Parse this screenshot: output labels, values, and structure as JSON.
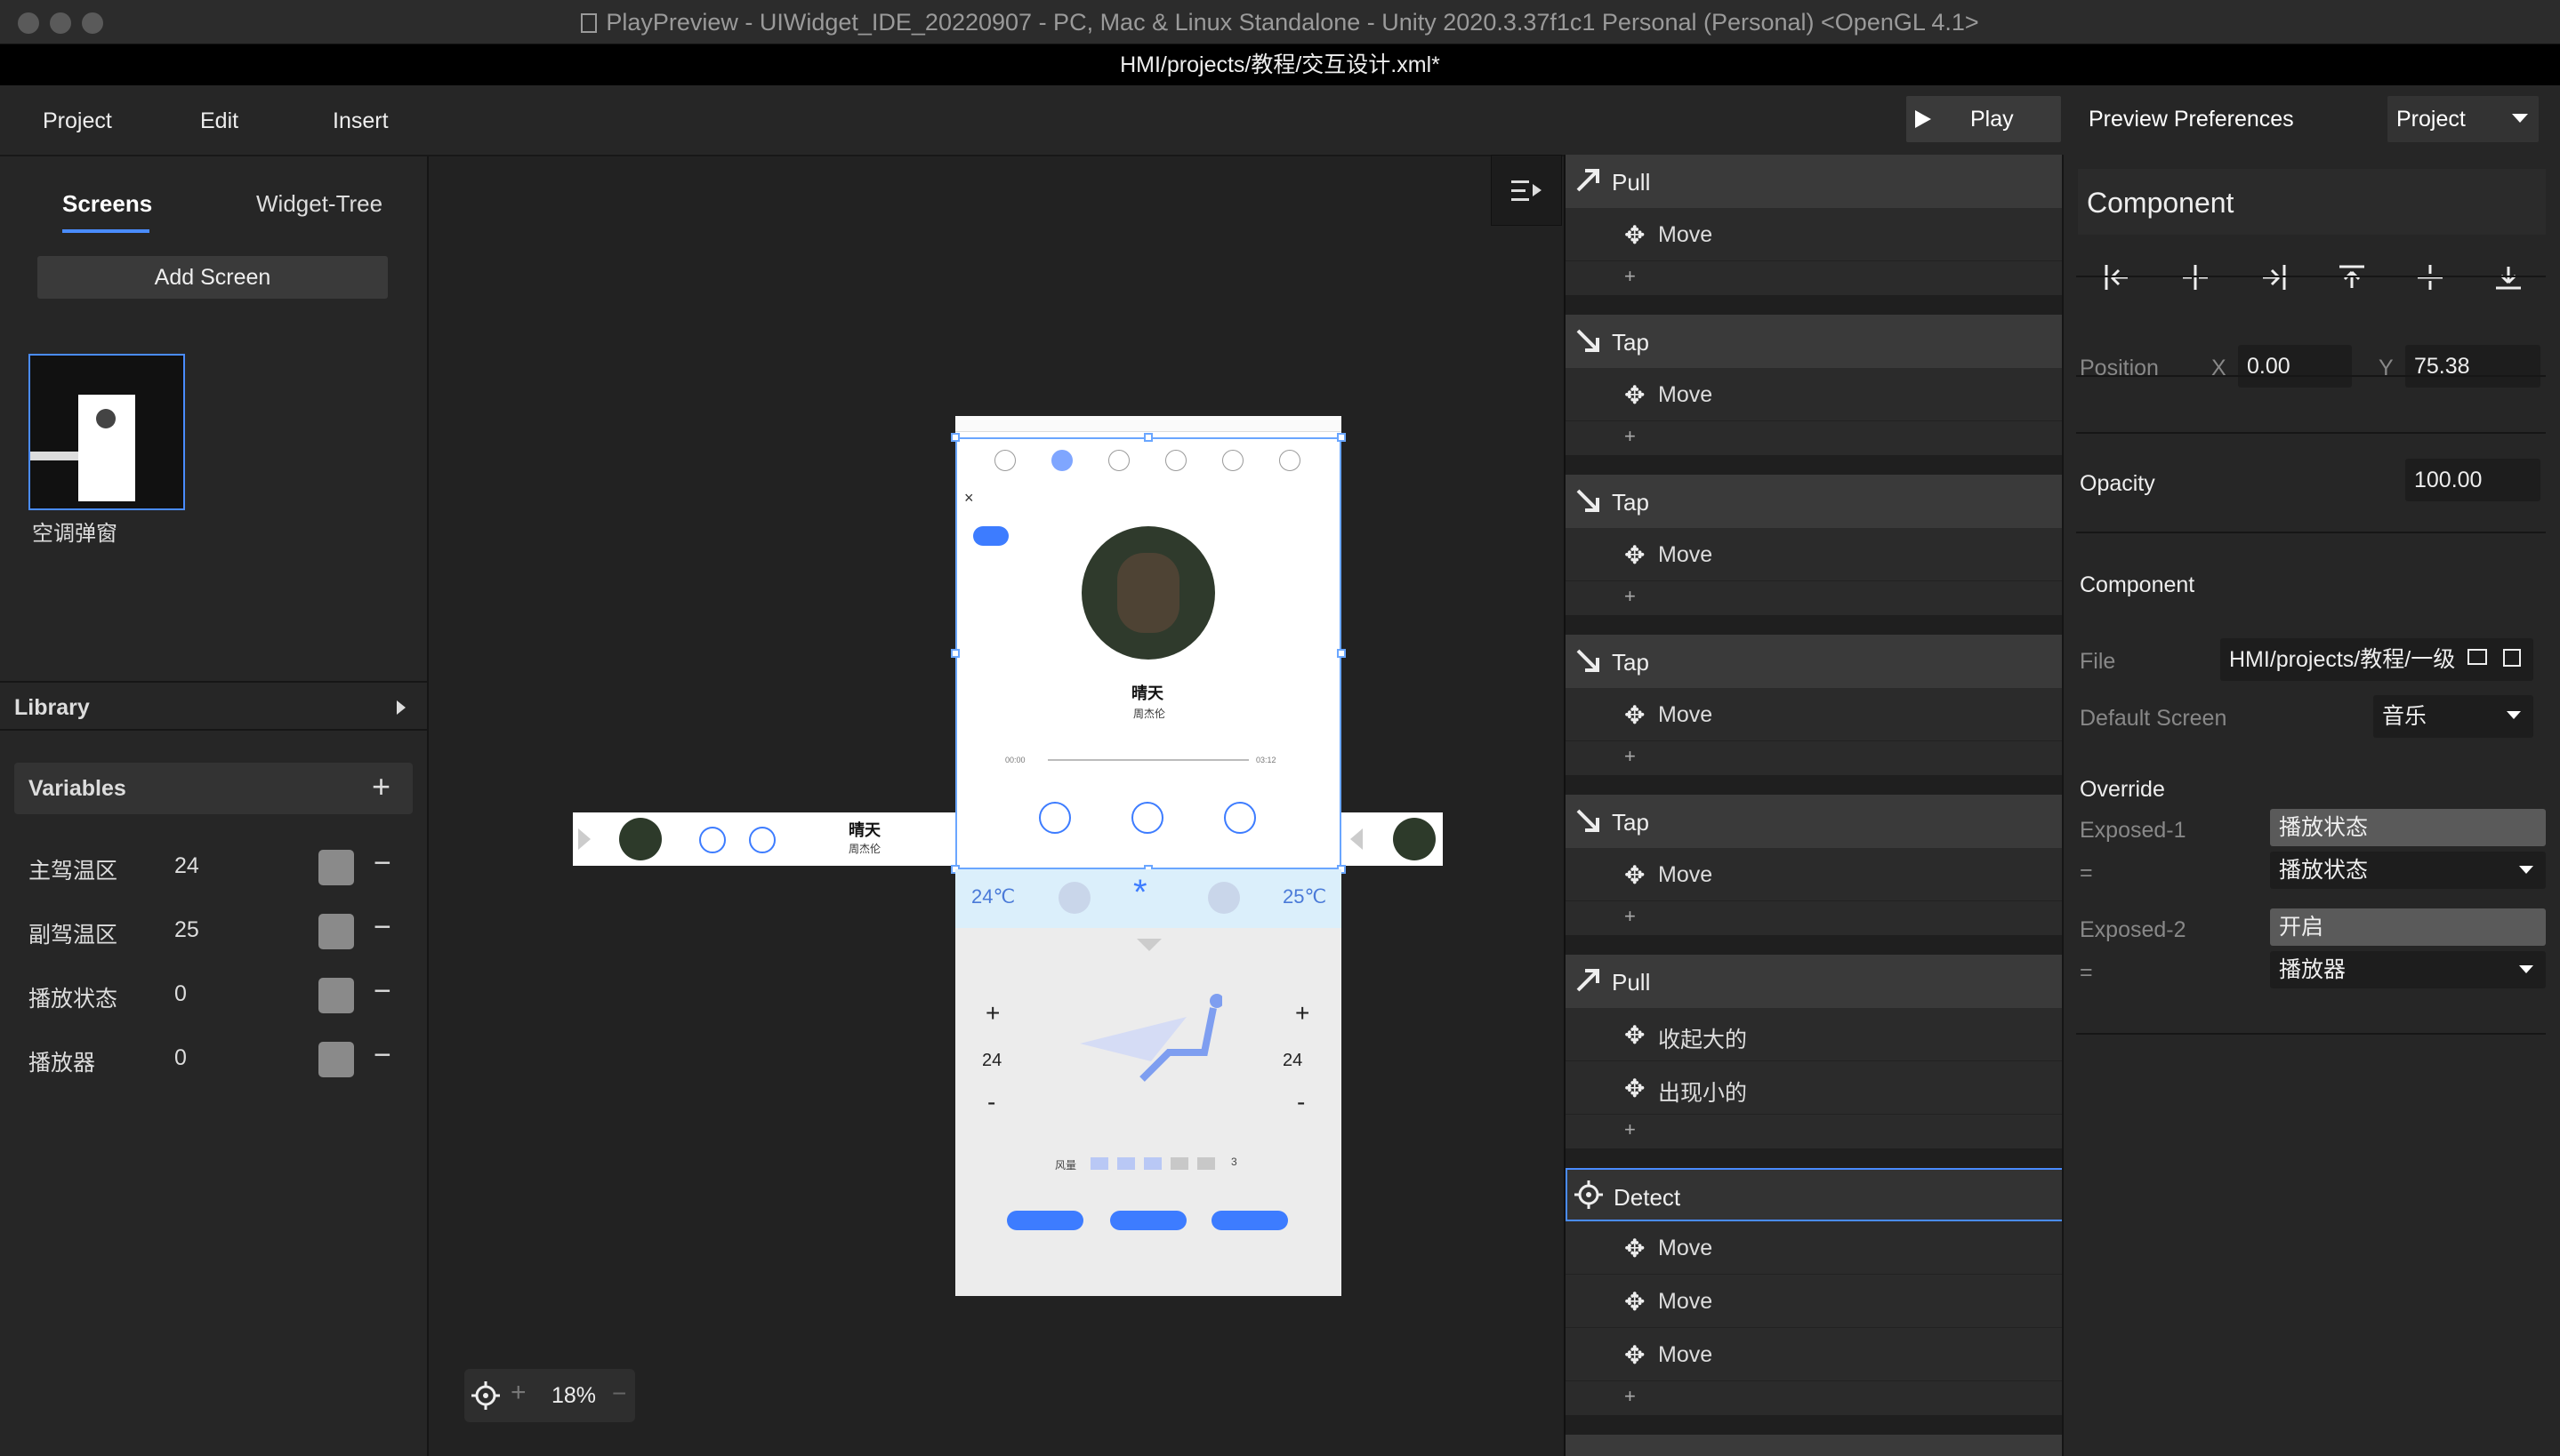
{
  "window": {
    "title": "PlayPreview - UIWidget_IDE_20220907 - PC, Mac & Linux Standalone - Unity 2020.3.37f1c1 Personal (Personal) <OpenGL 4.1>",
    "subtitle": "HMI/projects/教程/交互设计.xml*"
  },
  "menu": {
    "project": "Project",
    "edit": "Edit",
    "insert": "Insert",
    "play": "Play",
    "preferences": "Preview Preferences",
    "project_select": "Project"
  },
  "left": {
    "tab_screens": "Screens",
    "tab_widget_tree": "Widget-Tree",
    "add_screen": "Add Screen",
    "screen_name": "空调弹窗",
    "library": "Library",
    "variables": "Variables",
    "vars": [
      {
        "name": "主驾温区",
        "value": "24"
      },
      {
        "name": "副驾温区",
        "value": "25"
      },
      {
        "name": "播放状态",
        "value": "0"
      },
      {
        "name": "播放器",
        "value": "0"
      }
    ]
  },
  "canvas": {
    "zoom": "18%"
  },
  "phone": {
    "song": "晴天",
    "artist": "周杰伦",
    "time_start": "00:00",
    "time_end": "03:12",
    "temp_left": "24℃",
    "temp_right": "25℃",
    "ac_temp_left": "24",
    "ac_temp_right": "24",
    "wind_label": "风量",
    "wind_value": "3",
    "wind_level": 0.6
  },
  "interactions": [
    {
      "type": "Pull",
      "icon": "pull-icon",
      "actions": [
        "Move"
      ]
    },
    {
      "type": "Tap",
      "icon": "tap-icon",
      "actions": [
        "Move"
      ]
    },
    {
      "type": "Tap",
      "icon": "tap-icon",
      "actions": [
        "Move"
      ]
    },
    {
      "type": "Tap",
      "icon": "tap-icon",
      "actions": [
        "Move"
      ]
    },
    {
      "type": "Tap",
      "icon": "tap-icon",
      "actions": [
        "Move"
      ]
    },
    {
      "type": "Pull",
      "icon": "pull-icon",
      "actions": [
        "收起大的",
        "出现小的"
      ]
    },
    {
      "type": "Detect",
      "icon": "detect-icon",
      "actions": [
        "Move",
        "Move",
        "Move"
      ],
      "selected": true
    }
  ],
  "component": {
    "title": "Component",
    "position_label": "Position",
    "x_label": "X",
    "x": "0.00",
    "y_label": "Y",
    "y": "75.38",
    "opacity_label": "Opacity",
    "opacity": "100.00",
    "section": "Component",
    "file_label": "File",
    "file": "HMI/projects/教程/一级",
    "default_screen_label": "Default Screen",
    "default_screen": "音乐",
    "override": "Override",
    "exposed1_label": "Exposed-1",
    "exposed1": "播放状态",
    "exposed1_value": "播放状态",
    "eq": "=",
    "exposed2_label": "Exposed-2",
    "exposed2": "开启",
    "exposed2_value": "播放器"
  },
  "colors": {
    "accent": "#4a8cff",
    "selected_border": "#6aa6ff"
  }
}
